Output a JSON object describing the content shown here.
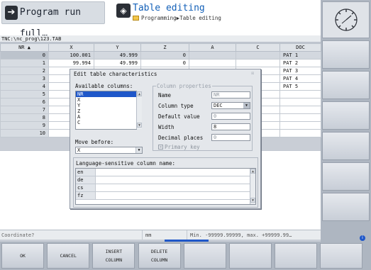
{
  "header": {
    "mode_run_label": "Program run full…",
    "mode_edit_title": "Table editing",
    "breadcrumb": "Programming▶Table editing"
  },
  "table": {
    "path": "TNC:\\nc_prog\\123.TAB",
    "columns": [
      "NR",
      "X",
      "Y",
      "Z",
      "A",
      "C",
      "DOC"
    ],
    "sort_indicator": "▲",
    "rows": [
      {
        "nr": "0",
        "x": "100.001",
        "y": "49.999",
        "z": "0",
        "a": "",
        "c": "",
        "doc": "PAT 1"
      },
      {
        "nr": "1",
        "x": "99.994",
        "y": "49.999",
        "z": "0",
        "a": "",
        "c": "",
        "doc": "PAT 2"
      },
      {
        "nr": "2",
        "x": "",
        "y": "",
        "z": "",
        "a": "",
        "c": "",
        "doc": "PAT 3"
      },
      {
        "nr": "3",
        "x": "",
        "y": "",
        "z": "",
        "a": "",
        "c": "",
        "doc": "PAT 4"
      },
      {
        "nr": "4",
        "x": "",
        "y": "",
        "z": "",
        "a": "",
        "c": "",
        "doc": "PAT 5"
      },
      {
        "nr": "5",
        "x": "",
        "y": "",
        "z": "",
        "a": "",
        "c": "",
        "doc": ""
      },
      {
        "nr": "6",
        "x": "",
        "y": "",
        "z": "",
        "a": "",
        "c": "",
        "doc": ""
      },
      {
        "nr": "7",
        "x": "",
        "y": "",
        "z": "",
        "a": "",
        "c": "",
        "doc": ""
      },
      {
        "nr": "8",
        "x": "",
        "y": "",
        "z": "",
        "a": "",
        "c": "",
        "doc": ""
      },
      {
        "nr": "9",
        "x": "",
        "y": "",
        "z": "",
        "a": "",
        "c": "",
        "doc": ""
      },
      {
        "nr": "10",
        "x": "",
        "y": "",
        "z": "",
        "a": "",
        "c": "",
        "doc": ""
      }
    ]
  },
  "dialog": {
    "title": "Edit table characteristics",
    "close_glyph": "☒",
    "available_columns_label": "Available columns:",
    "available_columns": [
      "NR",
      "X",
      "Y",
      "Z",
      "A",
      "C"
    ],
    "selected_column": "NR",
    "move_before_label": "Move before:",
    "move_before_value": "X",
    "column_properties_legend": "Column properties",
    "properties": {
      "name_label": "Name",
      "name_value": "NR",
      "type_label": "Column type",
      "type_value": "DEC",
      "default_label": "Default value",
      "default_value": "0",
      "width_label": "Width",
      "width_value": "8",
      "decimals_label": "Decimal places",
      "decimals_value": "0",
      "primary_key_label": "Primary key",
      "primary_key_checked": true
    },
    "language_legend": "Language-sensitive column name:",
    "languages": [
      "en",
      "de",
      "cs",
      "fz"
    ]
  },
  "status": {
    "coordinate_label": "Coordinate?",
    "unit": "mm",
    "range_text": "Min. -99999.99999, max. +99999.99…"
  },
  "softkeys": [
    {
      "line1": "OK",
      "line2": ""
    },
    {
      "line1": "CANCEL",
      "line2": ""
    },
    {
      "line1": "INSERT",
      "line2": "COLUMN"
    },
    {
      "line1": "DELETE",
      "line2": "COLUMN"
    },
    {
      "line1": "",
      "line2": ""
    },
    {
      "line1": "",
      "line2": ""
    },
    {
      "line1": "",
      "line2": ""
    },
    {
      "line1": "",
      "line2": ""
    }
  ],
  "colors": {
    "accent_blue": "#1f57c9",
    "title_blue": "#1360b8",
    "panel_gray": "#e4e7eb"
  }
}
